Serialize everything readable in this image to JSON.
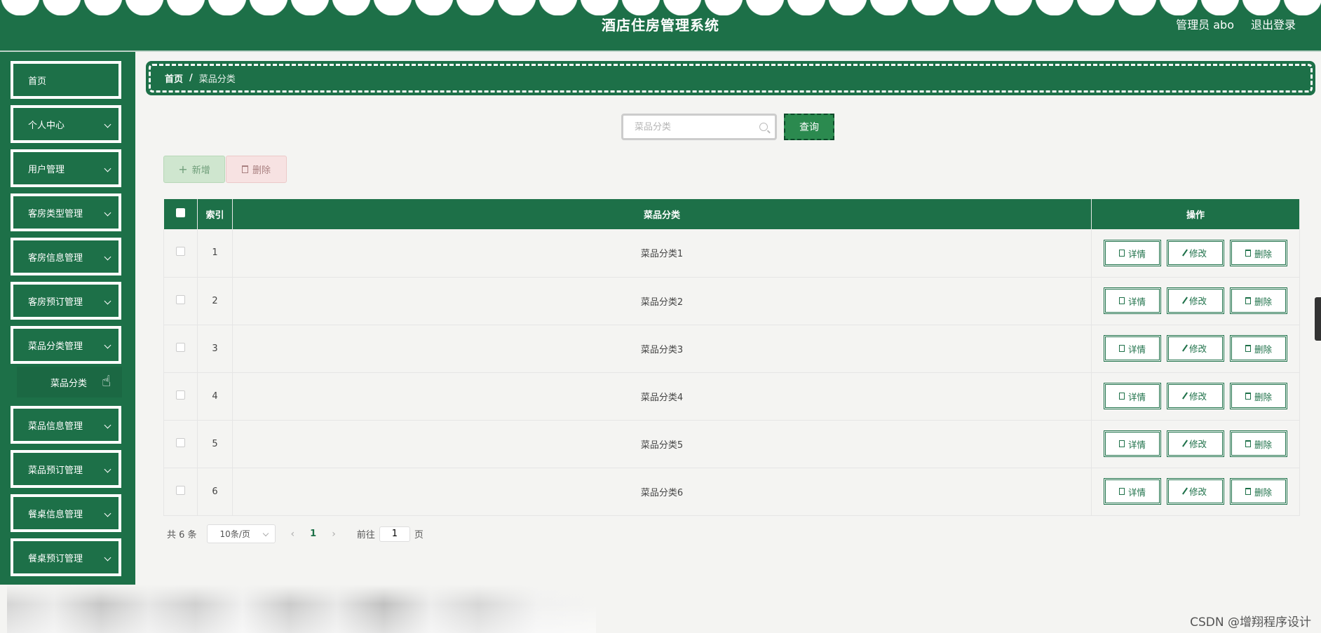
{
  "header": {
    "title": "酒店住房管理系统",
    "user_label": "管理员 abo",
    "logout_label": "退出登录"
  },
  "sidebar": {
    "items": [
      {
        "label": "首页"
      },
      {
        "label": "个人中心"
      },
      {
        "label": "用户管理"
      },
      {
        "label": "客房类型管理"
      },
      {
        "label": "客房信息管理"
      },
      {
        "label": "客房预订管理"
      },
      {
        "label": "菜品分类管理"
      },
      {
        "label": "菜品信息管理"
      },
      {
        "label": "菜品预订管理"
      },
      {
        "label": "餐桌信息管理"
      },
      {
        "label": "餐桌预订管理"
      }
    ],
    "sub_item": "菜品分类"
  },
  "breadcrumb": {
    "home": "首页",
    "separator": "/",
    "current": "菜品分类"
  },
  "search": {
    "placeholder": "菜品分类",
    "query_label": "查询"
  },
  "toolbar": {
    "add_label": "新增",
    "delete_label": "删除"
  },
  "table": {
    "headers": {
      "index": "索引",
      "category": "菜品分类",
      "actions": "操作"
    },
    "rows": [
      {
        "index": "1",
        "category": "菜品分类1"
      },
      {
        "index": "2",
        "category": "菜品分类2"
      },
      {
        "index": "3",
        "category": "菜品分类3"
      },
      {
        "index": "4",
        "category": "菜品分类4"
      },
      {
        "index": "5",
        "category": "菜品分类5"
      },
      {
        "index": "6",
        "category": "菜品分类6"
      }
    ],
    "actions": {
      "detail": "详情",
      "edit": "修改",
      "delete": "删除"
    }
  },
  "pagination": {
    "total": "共 6 条",
    "page_size": "10条/页",
    "current_page": "1",
    "goto_label": "前往",
    "goto_value": "1",
    "page_suffix": "页"
  },
  "watermark": "CSDN @增翔程序设计",
  "colors": {
    "primary": "#1d7048",
    "background": "#f4f4f2"
  }
}
